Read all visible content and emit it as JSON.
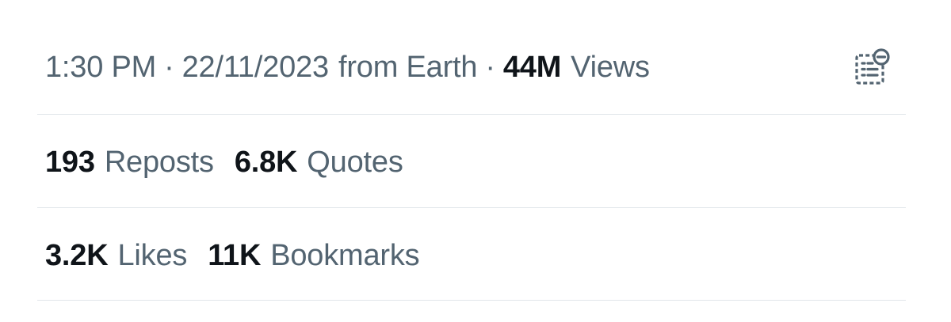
{
  "meta": {
    "time": "1:30 PM",
    "separator": "·",
    "date": "22/11/2023",
    "location": "from Earth",
    "views_count": "44M",
    "views_label": "Views"
  },
  "engagement": {
    "reposts_count": "193",
    "reposts_label": "Reposts",
    "quotes_count": "6.8K",
    "quotes_label": "Quotes",
    "likes_count": "3.2K",
    "likes_label": "Likes",
    "bookmarks_count": "11K",
    "bookmarks_label": "Bookmarks"
  },
  "icons": {
    "analytics": "analytics-remove-icon"
  },
  "colors": {
    "primary_text": "#0f1419",
    "secondary_text": "#536471",
    "divider": "#e1e6ea"
  }
}
